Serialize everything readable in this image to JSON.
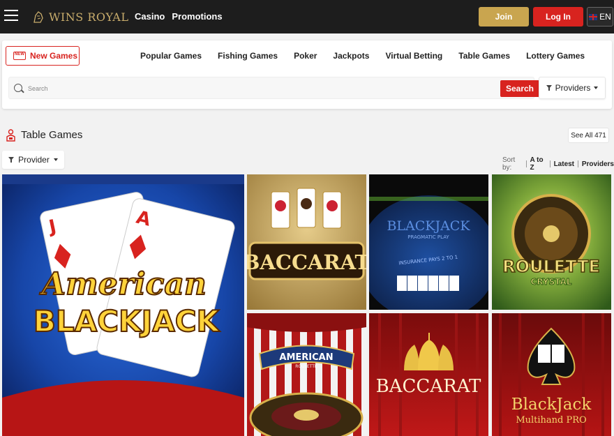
{
  "header": {
    "logo_text": "WINS ROYAL",
    "nav": [
      "Casino",
      "Promotions"
    ],
    "join_label": "Join",
    "login_label": "Log In",
    "lang_label": "EN"
  },
  "categories": {
    "new_games_label": "New Games",
    "items": [
      "Popular Games",
      "Fishing Games",
      "Poker",
      "Jackpots",
      "Virtual Betting",
      "Table Games",
      "Lottery Games"
    ]
  },
  "search": {
    "placeholder": "Search",
    "button_label": "Search",
    "providers_label": "Providers"
  },
  "section": {
    "title": "Table Games",
    "see_all_label": "See All 471",
    "provider_filter_label": "Provider",
    "sort_label": "Sort by:",
    "sort_options": [
      "A to Z",
      "Latest",
      "Providers"
    ]
  },
  "games": [
    {
      "title_line1": "American",
      "title_line2": "BLACKJACK"
    },
    {
      "title": "BACCARAT"
    },
    {
      "title": "BLACKJACK",
      "subtitle": "PRAGMATIC PLAY",
      "insurance": "INSURANCE PAYS 2 TO 1"
    },
    {
      "title": "ROULETTE",
      "subtitle": "CRYSTAL"
    },
    {
      "title": "AMERICAN",
      "subtitle": "ROULETTE"
    },
    {
      "title": "BACCARAT"
    },
    {
      "title": "BlackJack",
      "subtitle": "Multihand PRO"
    }
  ],
  "colors": {
    "topbar": "#1d1d1d",
    "brand_gold": "#c9ad6c",
    "join": "#c9a54f",
    "login": "#d8231f",
    "accent_red": "#d8231f"
  }
}
